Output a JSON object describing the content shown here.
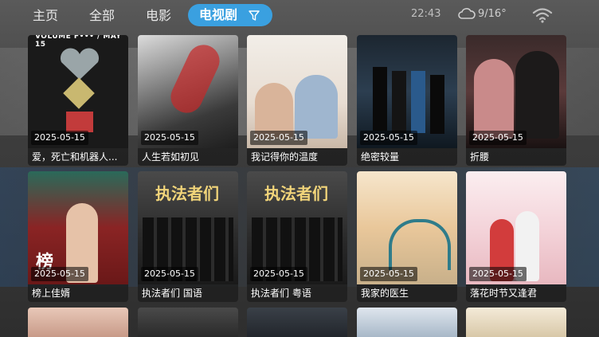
{
  "nav": {
    "items": [
      "主页",
      "全部",
      "电影"
    ],
    "active": "电视剧"
  },
  "status": {
    "time": "22:43",
    "temperature": "9/16°"
  },
  "cards": [
    {
      "date": "2025-05-15",
      "title": "爱，死亡和机器人...",
      "poster_text": "VOLUME F••• / MAY 15"
    },
    {
      "date": "2025-05-15",
      "title": "人生若如初见",
      "poster_text": ""
    },
    {
      "date": "2025-05-15",
      "title": "我记得你的温度",
      "poster_text": ""
    },
    {
      "date": "2025-05-15",
      "title": "绝密较量",
      "poster_text": ""
    },
    {
      "date": "2025-05-15",
      "title": "折腰",
      "poster_text": ""
    },
    {
      "date": "2025-05-15",
      "title": "榜上佳婿",
      "poster_text": "榜"
    },
    {
      "date": "2025-05-15",
      "title": "执法者们 国语",
      "poster_text": "执法者们"
    },
    {
      "date": "2025-05-15",
      "title": "执法者们 粤语",
      "poster_text": "执法者们"
    },
    {
      "date": "2025-05-15",
      "title": "我家的医生",
      "poster_text": ""
    },
    {
      "date": "2025-05-15",
      "title": "落花时节又逢君",
      "poster_text": ""
    }
  ],
  "colors": {
    "accent": "#3aa0e0"
  }
}
